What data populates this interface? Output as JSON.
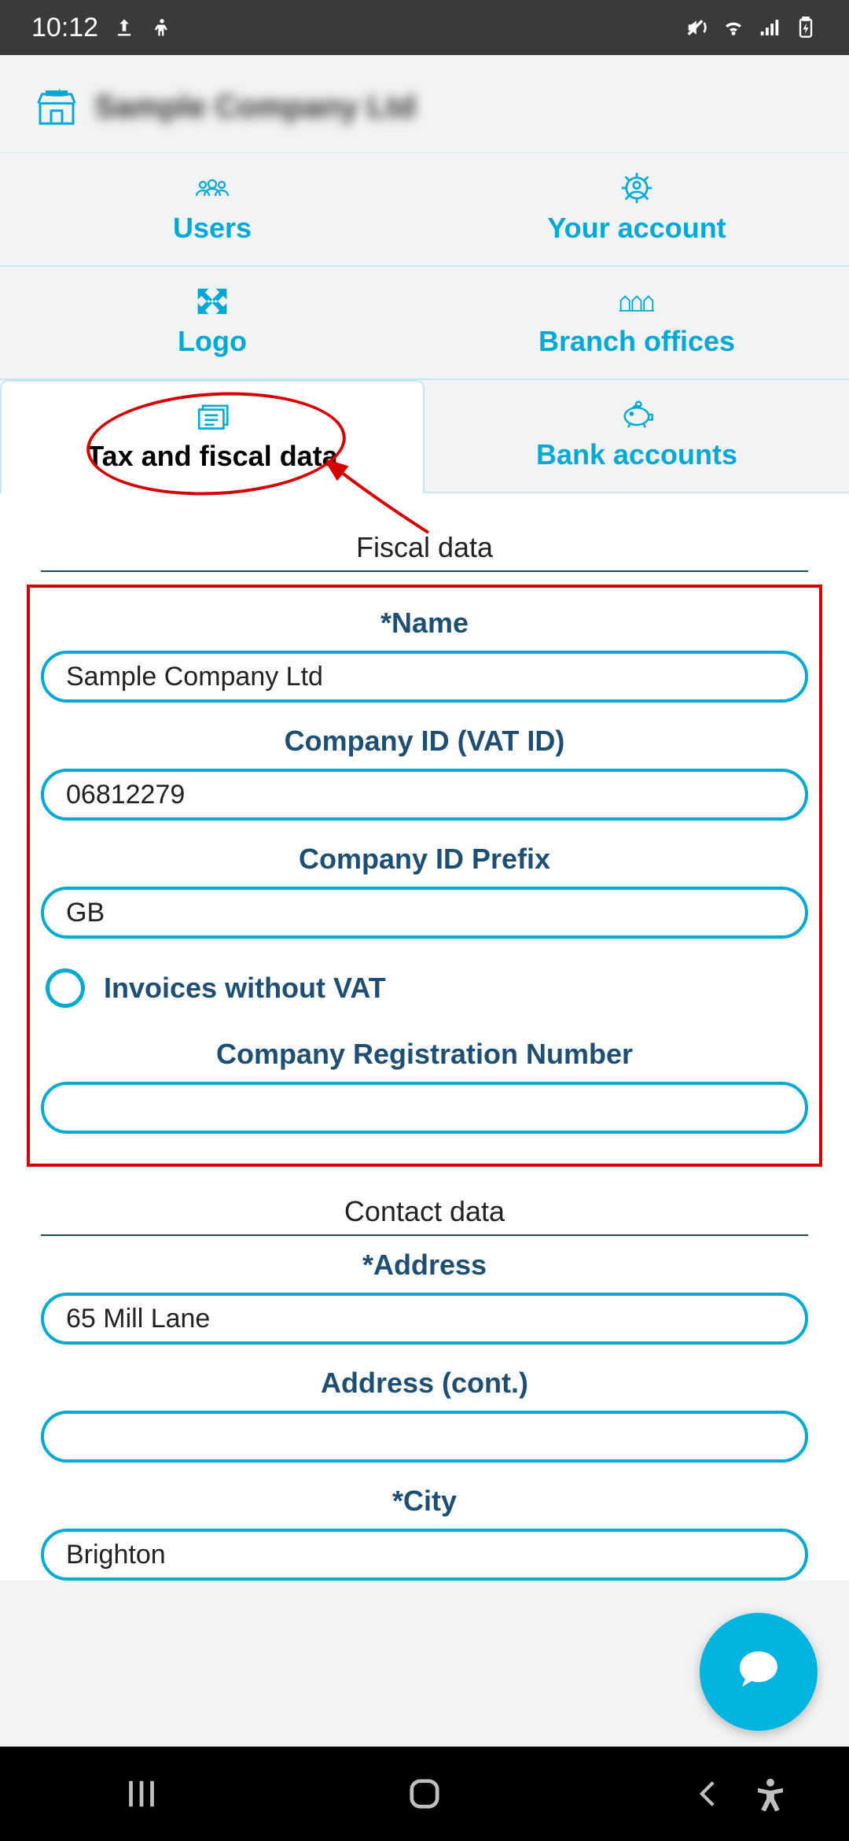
{
  "status": {
    "time": "10:12"
  },
  "company_name": "Sample Company Ltd",
  "nav": {
    "users": "Users",
    "your_account": "Your account",
    "logo": "Logo",
    "branch_offices": "Branch offices",
    "tax_fiscal": "Tax and fiscal data",
    "bank_accounts": "Bank accounts"
  },
  "sections": {
    "fiscal": "Fiscal data",
    "contact": "Contact data"
  },
  "labels": {
    "name": "Name",
    "company_id": "Company ID (VAT ID)",
    "company_id_prefix": "Company ID Prefix",
    "invoices_without_vat": "Invoices without VAT",
    "company_reg_num": "Company Registration Number",
    "address": "Address",
    "address_cont": "Address (cont.)",
    "city": "City"
  },
  "values": {
    "name": "Sample Company Ltd",
    "company_id": "06812279",
    "company_id_prefix": "GB",
    "company_reg_num": "",
    "address": "65 Mill Lane",
    "address_cont": "",
    "city": "Brighton"
  },
  "required_mark": "*"
}
